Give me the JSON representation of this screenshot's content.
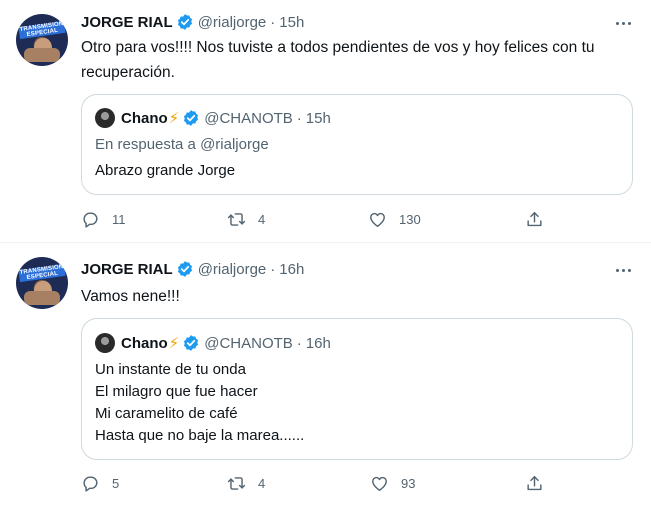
{
  "colors": {
    "accent": "#1d9bf0",
    "text": "#0f1419",
    "muted": "#536471",
    "border": "#cfd9de",
    "bolt": "#f4a000"
  },
  "tweets": [
    {
      "author": {
        "name": "JORGE RIAL",
        "handle": "@rialjorge",
        "avatar_icon": "avatar-photo",
        "avatar_band": "TRANSMISION ESPECIAL"
      },
      "separator": "·",
      "time": "15h",
      "text_lines": [
        "Otro para vos!!!! Nos tuviste a todos pendientes de vos y hoy felices con tu",
        "recuperación."
      ],
      "quote": {
        "author": {
          "name": "Chano",
          "bolt": "⚡",
          "handle": "@CHANOTB"
        },
        "time": "15h",
        "reply_prefix": "En respuesta a",
        "reply_mention": "@rialjorge",
        "lines": [
          "Abrazo grande Jorge"
        ]
      },
      "actions": {
        "replies": "11",
        "retweets": "4",
        "likes": "130"
      }
    },
    {
      "author": {
        "name": "JORGE RIAL",
        "handle": "@rialjorge",
        "avatar_icon": "avatar-photo",
        "avatar_band": "TRANSMISION ESPECIAL"
      },
      "separator": "·",
      "time": "16h",
      "text_lines": [
        "Vamos nene!!!"
      ],
      "quote": {
        "author": {
          "name": "Chano",
          "bolt": "⚡",
          "handle": "@CHANOTB"
        },
        "time": "16h",
        "lines": [
          "Un instante de tu onda",
          "El milagro que fue hacer",
          "Mi caramelito de café",
          "Hasta que no baje la marea......"
        ]
      },
      "actions": {
        "replies": "5",
        "retweets": "4",
        "likes": "93"
      }
    }
  ]
}
